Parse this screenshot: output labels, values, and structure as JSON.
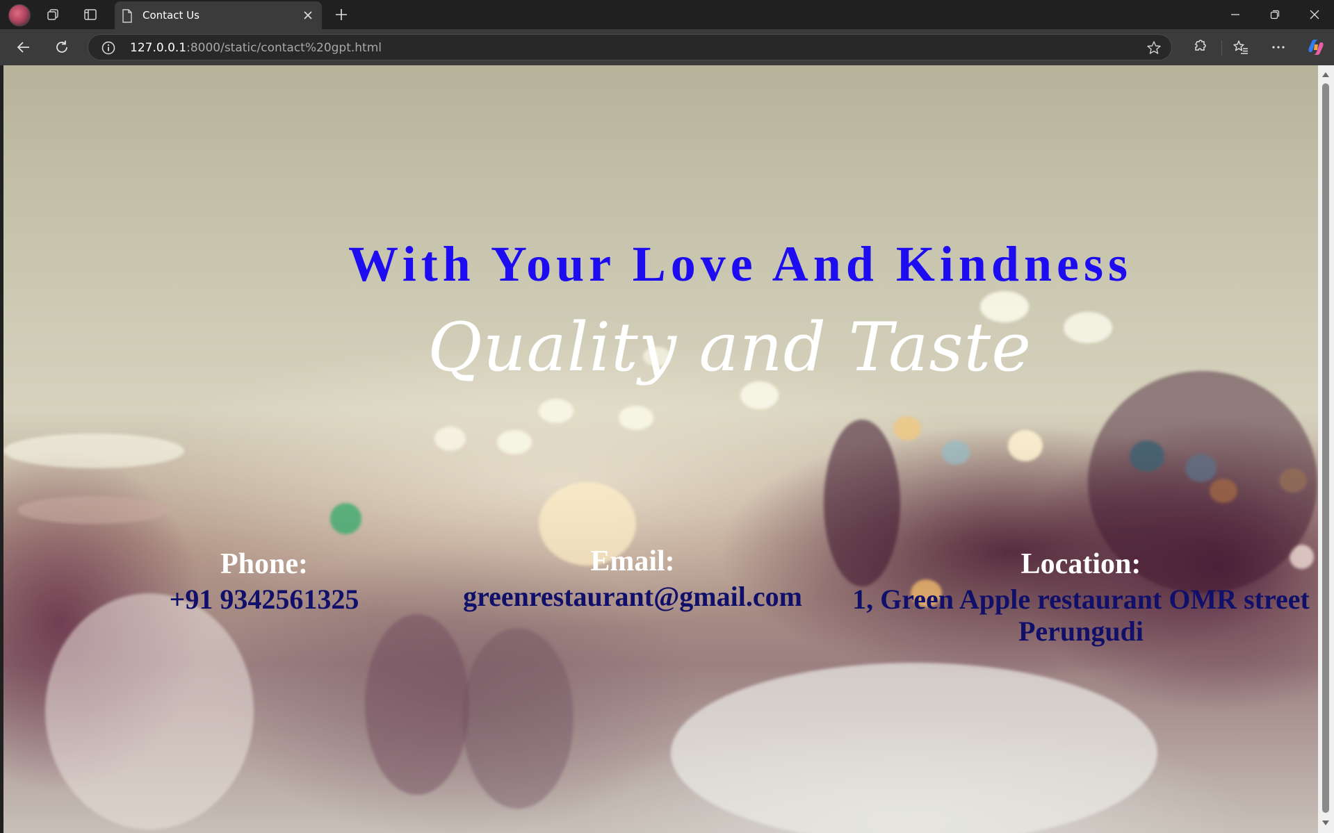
{
  "browser": {
    "tab_title": "Contact Us",
    "url_host": "127.0.0.1",
    "url_rest": ":8000/static/contact%20gpt.html"
  },
  "page": {
    "headline": "With Your Love And Kindness",
    "tagline": "Quality and Taste",
    "contact": {
      "phone_label": "Phone:",
      "phone_value": "+91 9342561325",
      "email_label": "Email:",
      "email_value": "greenrestaurant@gmail.com",
      "location_label": "Location:",
      "location_line1": "1, Green Apple restaurant OMR street",
      "location_line2": "Perungudi"
    }
  },
  "colors": {
    "headline": "#1d0cf0",
    "contact_value": "#10106a",
    "contact_label": "#ffffff"
  }
}
